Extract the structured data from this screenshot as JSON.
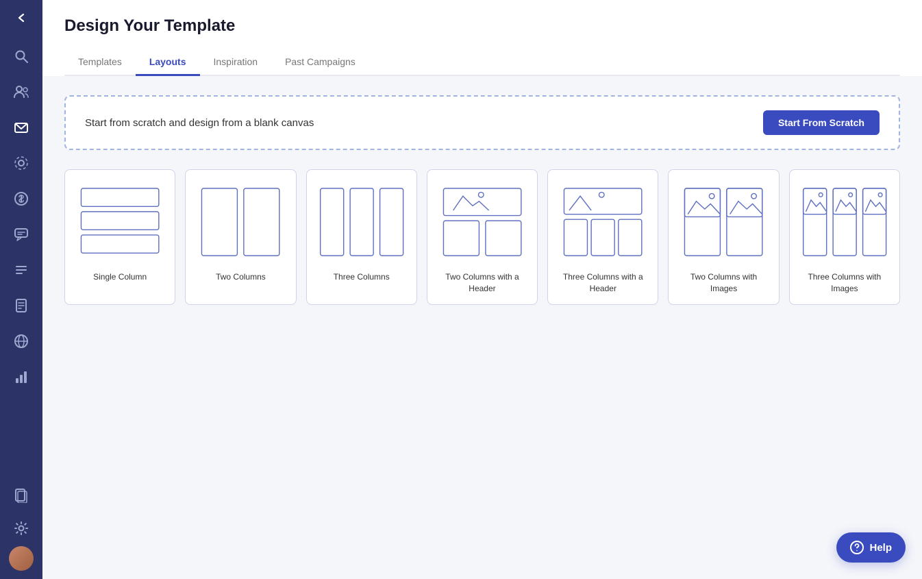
{
  "page": {
    "title": "Design Your Template"
  },
  "tabs": [
    {
      "id": "templates",
      "label": "Templates",
      "active": false
    },
    {
      "id": "layouts",
      "label": "Layouts",
      "active": true
    },
    {
      "id": "inspiration",
      "label": "Inspiration",
      "active": false
    },
    {
      "id": "past-campaigns",
      "label": "Past Campaigns",
      "active": false
    }
  ],
  "scratch_banner": {
    "text": "Start from scratch and design from a blank canvas",
    "button_label": "Start From Scratch"
  },
  "templates": [
    {
      "id": "single-column",
      "label": "Single Column",
      "type": "single"
    },
    {
      "id": "two-columns",
      "label": "Two Columns",
      "type": "two"
    },
    {
      "id": "three-columns",
      "label": "Three Columns",
      "type": "three"
    },
    {
      "id": "two-columns-header",
      "label": "Two Columns with a Header",
      "type": "two-header"
    },
    {
      "id": "three-columns-header",
      "label": "Three Columns with a Header",
      "type": "three-header"
    },
    {
      "id": "two-columns-images",
      "label": "Two Columns with Images",
      "type": "two-images"
    },
    {
      "id": "three-columns-images",
      "label": "Three Columns with Images",
      "type": "three-images"
    }
  ],
  "sidebar": {
    "items": [
      {
        "id": "search",
        "icon": "search"
      },
      {
        "id": "users",
        "icon": "users"
      },
      {
        "id": "email",
        "icon": "email"
      },
      {
        "id": "automation",
        "icon": "automation"
      },
      {
        "id": "dollar",
        "icon": "dollar"
      },
      {
        "id": "chat",
        "icon": "chat"
      },
      {
        "id": "list",
        "icon": "list"
      },
      {
        "id": "doc",
        "icon": "doc"
      },
      {
        "id": "globe",
        "icon": "globe"
      },
      {
        "id": "chart",
        "icon": "chart"
      }
    ]
  },
  "help_button": {
    "label": "Help"
  }
}
